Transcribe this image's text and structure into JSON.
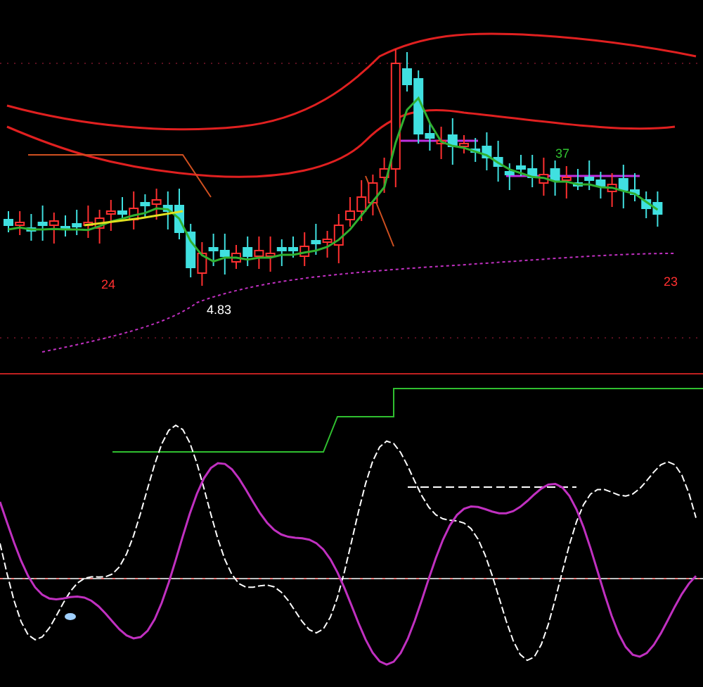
{
  "price_chart": {
    "labels": [
      {
        "text": "24",
        "color": "#ff3030"
      },
      {
        "text": "4.83",
        "color": "#ffffff"
      },
      {
        "text": "37",
        "color": "#30c030"
      },
      {
        "text": "23",
        "color": "#ff3030"
      }
    ]
  }
}
